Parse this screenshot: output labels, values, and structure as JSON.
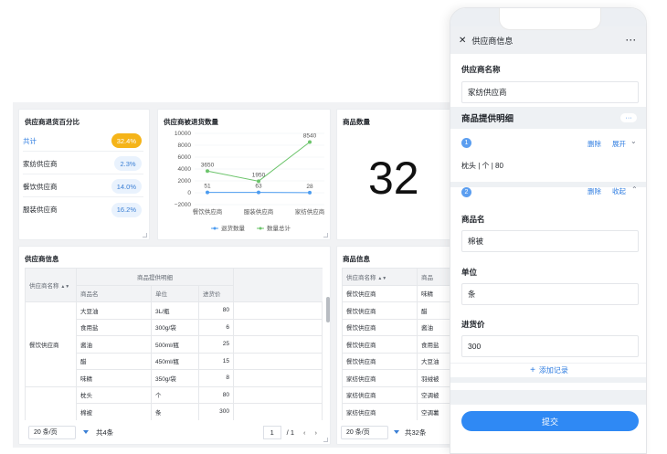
{
  "card_ratio": {
    "title": "供应商退货百分比",
    "rows": [
      {
        "name": "共计",
        "value": "32.4%"
      },
      {
        "name": "家纺供应商",
        "value": "2.3%"
      },
      {
        "name": "餐饮供应商",
        "value": "14.0%"
      },
      {
        "name": "服装供应商",
        "value": "16.2%"
      }
    ]
  },
  "card_qty": {
    "title": "商品数量",
    "value": "32"
  },
  "chart_data": {
    "type": "line",
    "title": "供应商被退货数量",
    "categories": [
      "餐饮供应商",
      "服装供应商",
      "家纺供应商"
    ],
    "ylim": [
      -2000,
      10000
    ],
    "yticks": [
      "10000",
      "8000",
      "6000",
      "4000",
      "2000",
      "0",
      "−2000"
    ],
    "series": [
      {
        "name": "退货数量",
        "values": [
          51,
          63,
          28
        ],
        "color": "#4c9cf0"
      },
      {
        "name": "数量总计",
        "values": [
          3650,
          1950,
          8540
        ],
        "color": "#6cc46b"
      }
    ],
    "labels": [
      "51",
      "63",
      "28",
      "3650",
      "1950",
      "8540"
    ],
    "legend": "bottom"
  },
  "card_supplier": {
    "title": "供应商信息",
    "h_name": "供应商名称",
    "h_group": "商品提供明细",
    "h_item": "商品名",
    "h_unit": "单位",
    "h_price": "进货价",
    "group_name": "餐饮供应商",
    "rows": [
      {
        "item": "大豆油",
        "unit": "3L/瓶",
        "price": "80"
      },
      {
        "item": "食用盐",
        "unit": "300g/袋",
        "price": "6"
      },
      {
        "item": "酱油",
        "unit": "500ml/瓶",
        "price": "25"
      },
      {
        "item": "醋",
        "unit": "450ml/瓶",
        "price": "15"
      },
      {
        "item": "味精",
        "unit": "350g/袋",
        "price": "8"
      },
      {
        "item": "枕头",
        "unit": "个",
        "price": "80"
      },
      {
        "item": "棉被",
        "unit": "条",
        "price": "300"
      }
    ],
    "page_size": "20 条/页",
    "total": "共4条",
    "page": "1",
    "pages": "/ 1"
  },
  "card_goods": {
    "title": "商品信息",
    "h_name": "供应商名称",
    "h_item": "商品",
    "rows": [
      {
        "name": "餐饮供应商",
        "item": "味精"
      },
      {
        "name": "餐饮供应商",
        "item": "醋"
      },
      {
        "name": "餐饮供应商",
        "item": "酱油"
      },
      {
        "name": "餐饮供应商",
        "item": "食用盐"
      },
      {
        "name": "餐饮供应商",
        "item": "大豆油"
      },
      {
        "name": "家纺供应商",
        "item": "羽绒被"
      },
      {
        "name": "家纺供应商",
        "item": "空调被"
      },
      {
        "name": "家纺供应商",
        "item": "空调薯"
      }
    ],
    "page_size": "20 条/页",
    "total": "共32条"
  },
  "phone": {
    "title": "供应商信息",
    "name_label": "供应商名称",
    "name_value": "家纺供应商",
    "section": "商品提供明细",
    "r1_num": "1",
    "delete": "删除",
    "expand": "展开",
    "collapse": "收起",
    "r1_summary": "枕头 | 个 | 80",
    "r2_num": "2",
    "item_label": "商品名",
    "item_value": "棉被",
    "unit_label": "单位",
    "unit_value": "条",
    "price_label": "进货价",
    "price_value": "300",
    "add": "添加记录",
    "submit": "提交"
  },
  "icons": {
    "close": "close-icon",
    "more": "more-icon",
    "add": "plus-icon",
    "sort": "sort-icon"
  }
}
